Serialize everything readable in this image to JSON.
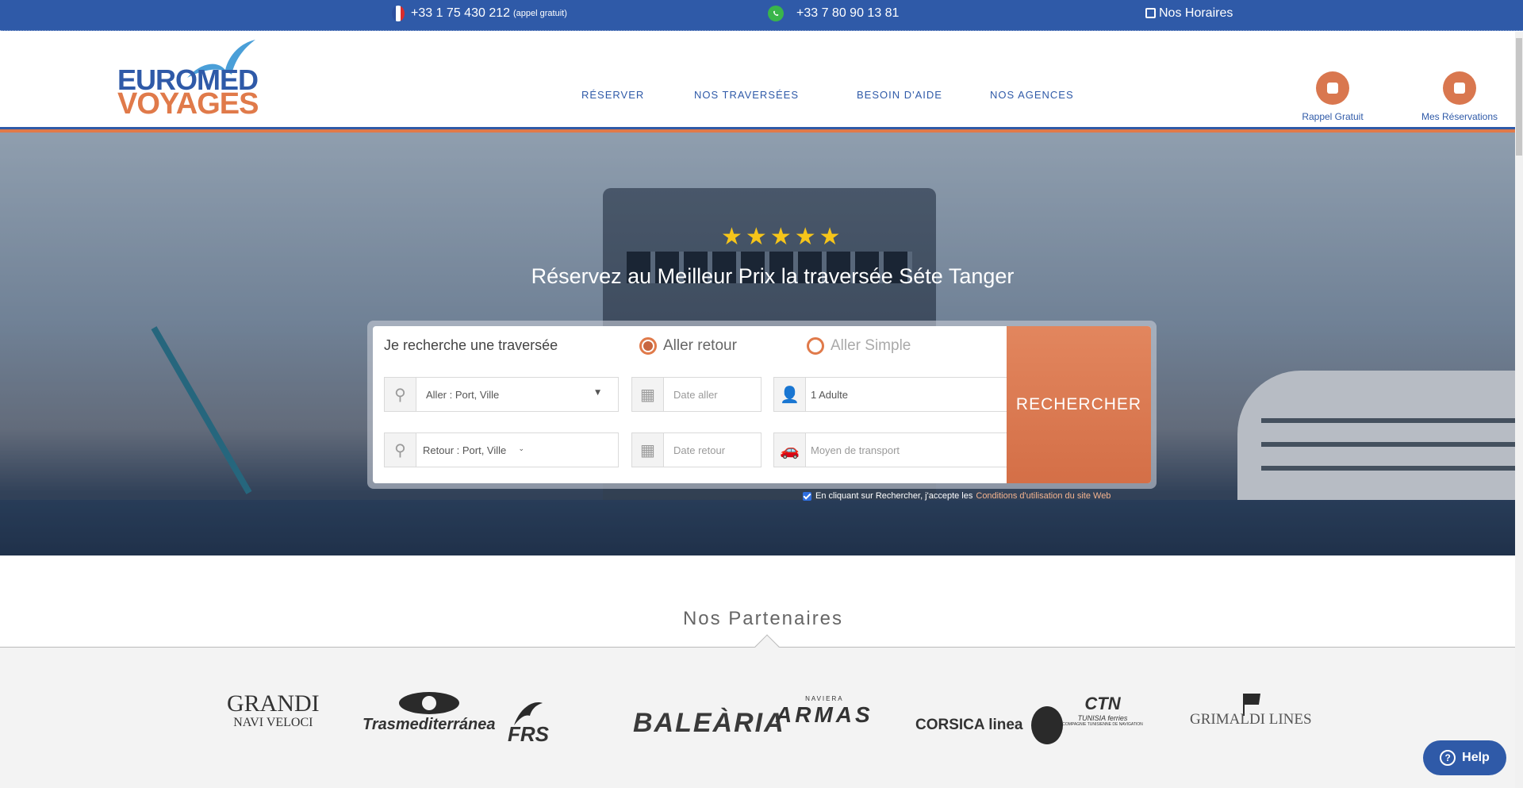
{
  "topbar": {
    "phone_fr": "+33 1 75 430 212",
    "phone_fr_note": "(appel gratuit)",
    "phone_whatsapp": "+33 7 80 90 13 81",
    "horaires": "Nos Horaires"
  },
  "brand": {
    "line1": "EUROMED",
    "line2": "VOYAGES"
  },
  "nav": {
    "reserver": "RÉSERVER",
    "traversees": "NOS TRAVERSÉES",
    "aide": "BESOIN D'AIDE",
    "agences": "NOS AGENCES"
  },
  "header_actions": {
    "rappel": "Rappel Gratuit",
    "reservations": "Mes Réservations"
  },
  "hero": {
    "rating": 5,
    "title": "Réservez au Meilleur Prix la traversée  Séte Tanger"
  },
  "search": {
    "label": "Je recherche une traversée",
    "trip_round": "Aller retour",
    "trip_oneway": "Aller Simple",
    "selected_trip": "Aller retour",
    "aller_port": "Aller : Port, Ville",
    "retour_port": "Retour : Port, Ville",
    "date_aller_placeholder": "Date aller",
    "date_retour_placeholder": "Date retour",
    "passengers": "1 Adulte",
    "transport_placeholder": "Moyen de transport",
    "button": "RECHERCHER",
    "consent_text": "En cliquant sur Rechercher, j'accepte les",
    "consent_link": "Conditions d'utilisation du site Web"
  },
  "partners": {
    "title": "Nos Partenaires",
    "logos": [
      {
        "line1": "GRANDI",
        "line2": "NAVI VELOCI"
      },
      {
        "line1": "Trasmediterránea"
      },
      {
        "line1": "FRS"
      },
      {
        "line1": "BALEÀRIA"
      },
      {
        "line1": "ARMAS",
        "line2": "NAVIERA"
      },
      {
        "line1": "CORSICA linea"
      },
      {
        "line1": "CTN",
        "line2": "TUNISIA ferries",
        "line3": "COMPAGNIE TUNISIENNE DE NAVIGATION"
      },
      {
        "line1": "GRIMALDI LINES"
      }
    ]
  },
  "help": {
    "label": "Help"
  },
  "colors": {
    "primary": "#2f5aa8",
    "accent": "#e07a4a",
    "star": "#f6c51a"
  }
}
